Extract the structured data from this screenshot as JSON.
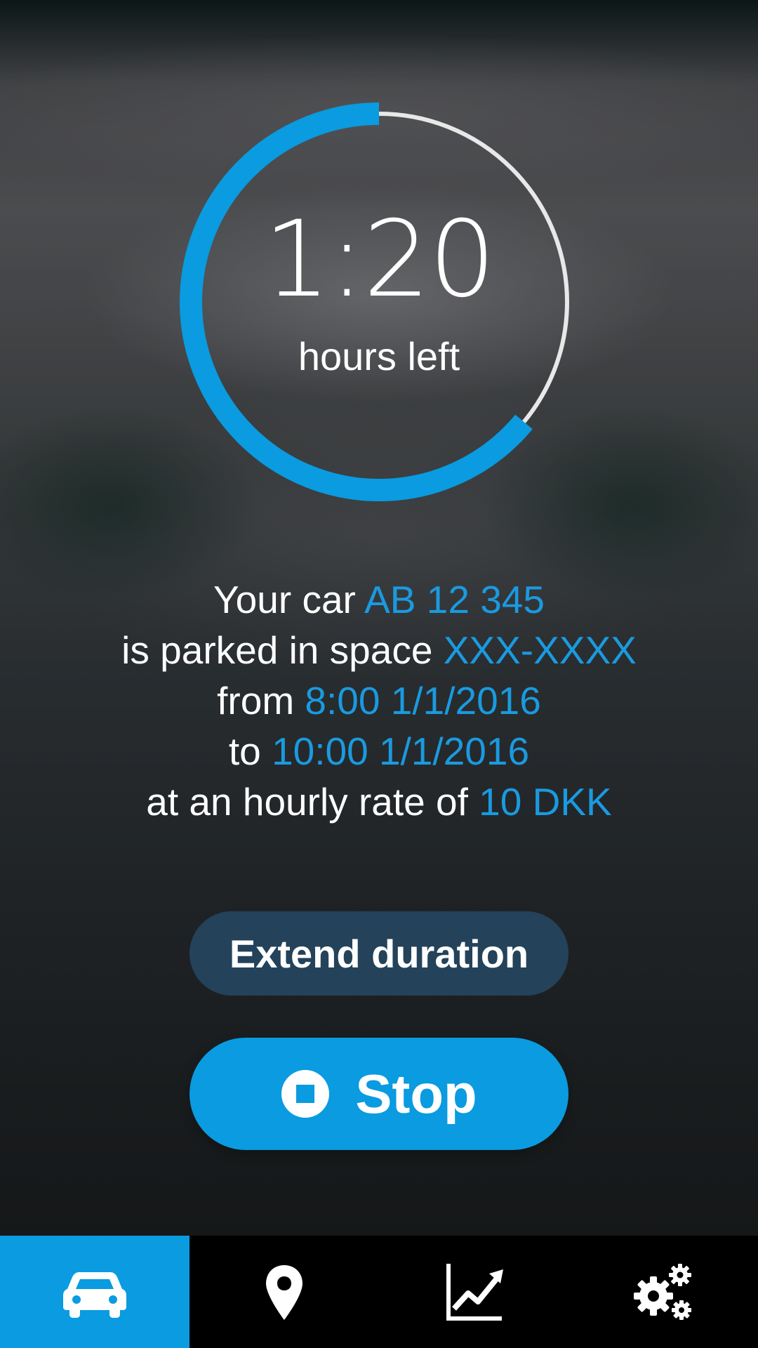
{
  "timer": {
    "value": "1:20",
    "label": "hours left",
    "remaining_fraction": 0.64,
    "progress_color": "#0a9be0",
    "track_color": "#e8e8e8"
  },
  "info": {
    "line1_prefix": "Your car ",
    "plate": "AB 12 345",
    "line2_prefix": "is parked in space ",
    "space": "XXX-XXXX",
    "line3_prefix": "from ",
    "start": "8:00 1/1/2016",
    "line4_prefix": "to ",
    "end": "10:00 1/1/2016",
    "line5_prefix": "at an hourly rate of ",
    "rate": "10 DKK",
    "accent_color": "#1a9ae0"
  },
  "actions": {
    "extend_label": "Extend duration",
    "stop_label": "Stop"
  },
  "nav": {
    "items": [
      {
        "icon": "car-icon",
        "active": true
      },
      {
        "icon": "map-pin-icon",
        "active": false
      },
      {
        "icon": "trending-chart-icon",
        "active": false
      },
      {
        "icon": "settings-gears-icon",
        "active": false
      }
    ],
    "active_color": "#0a9be0"
  }
}
